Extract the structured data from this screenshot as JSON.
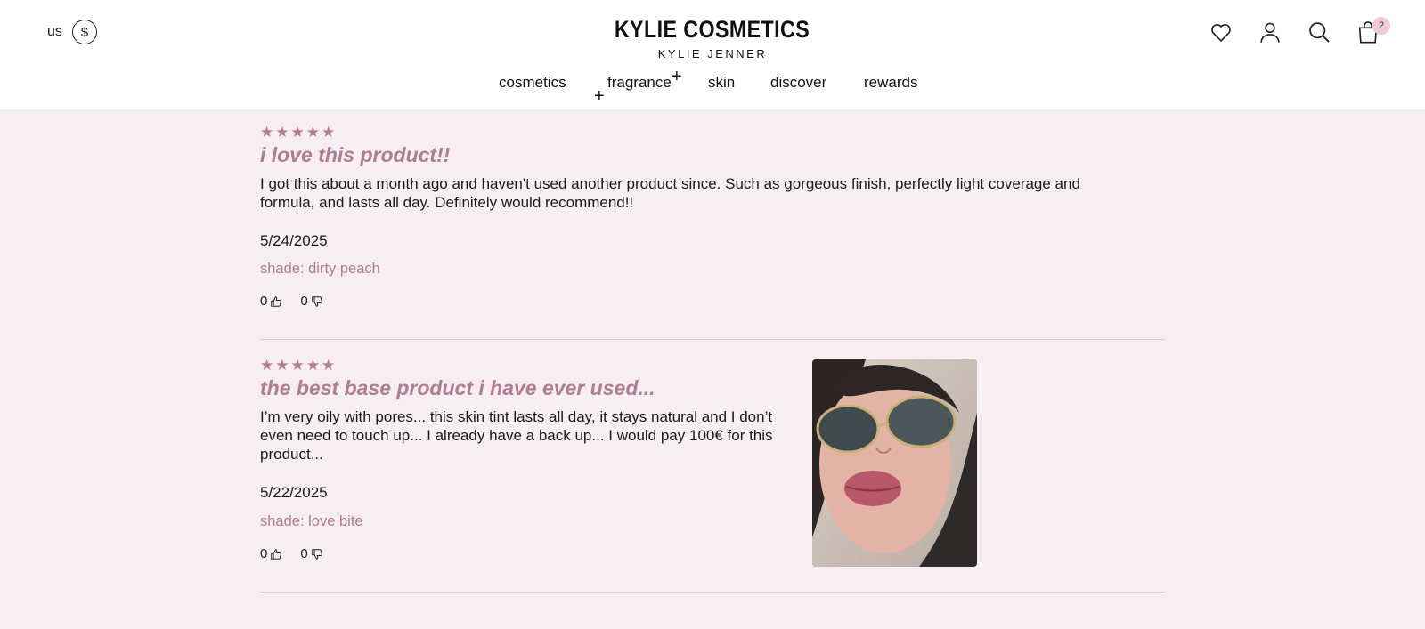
{
  "header": {
    "region": "us",
    "currency_symbol": "$",
    "brand": "KYLIE COSMETICS",
    "brand_sub": "KYLIE JENNER",
    "cart_count": "2",
    "nav": [
      "cosmetics",
      "fragrance",
      "skin",
      "discover",
      "rewards"
    ]
  },
  "reviews": [
    {
      "stars": "★★★★★",
      "title": "i love this product!!",
      "body": "I got this about a month ago and haven't used another product since. Such as gorgeous finish, perfectly light coverage and formula, and lasts all day. Definitely would recommend!!",
      "date": "5/24/2025",
      "shade": "shade: dirty peach",
      "helpful": "0",
      "unhelpful": "0"
    },
    {
      "stars": "★★★★★",
      "title": "the best base product i have ever used...",
      "body": "I’m very oily with pores... this skin tint lasts all day, it stays natural and I don’t even need to touch up... I already have a back up... I would pay 100€ for this product...",
      "date": "5/22/2025",
      "shade": "shade: love bite",
      "helpful": "0",
      "unhelpful": "0"
    }
  ],
  "colors": {
    "accent": "#b07b93",
    "background": "#f6eef1",
    "badge": "#f0c9dc"
  },
  "icons": [
    "dollar-icon",
    "heart-icon",
    "account-icon",
    "search-icon",
    "bag-icon",
    "thumbs-up-icon",
    "thumbs-down-icon",
    "sparkle-icon"
  ]
}
